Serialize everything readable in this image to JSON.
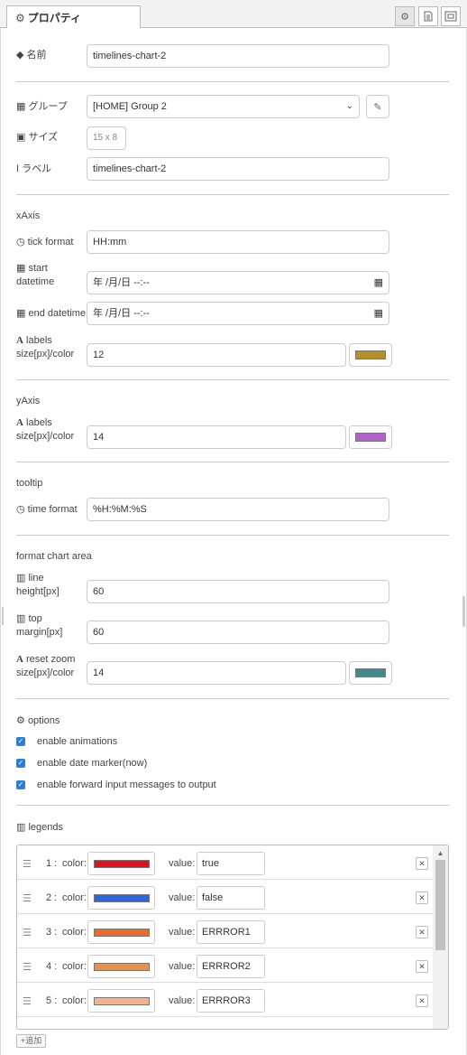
{
  "tab": {
    "title": "プロパティ"
  },
  "fields": {
    "name_label": "名前",
    "name_value": "timelines-chart-2",
    "group_label": "グループ",
    "group_value": "[HOME] Group 2",
    "size_label": "サイズ",
    "size_value": "15 x 8",
    "label_label": "ラベル",
    "label_value": "timelines-chart-2"
  },
  "xaxis": {
    "title": "xAxis",
    "tick_format_label": "tick format",
    "tick_format_value": "HH:mm",
    "start_label_1": "start",
    "start_label_2": "datetime",
    "start_value": "年 /月/日 --:--",
    "end_label": "end datetime",
    "end_value": "年 /月/日 --:--",
    "labels_label_1": "labels",
    "labels_label_2": "size[px]/color",
    "labels_size": "12",
    "labels_color": "#b58e27"
  },
  "yaxis": {
    "title": "yAxis",
    "labels_label_1": "labels",
    "labels_label_2": "size[px]/color",
    "labels_size": "14",
    "labels_color": "#b25fd0"
  },
  "tooltip": {
    "title": "tooltip",
    "time_format_label": "time format",
    "time_format_value": "%H:%M:%S"
  },
  "chart_area": {
    "title": "format chart area",
    "line_label_1": "line",
    "line_label_2": "height[px]",
    "line_value": "60",
    "top_label_1": "top",
    "top_label_2": "margin[px]",
    "top_value": "60",
    "reset_label_1": "reset zoom",
    "reset_label_2": "size[px]/color",
    "reset_size": "14",
    "reset_color": "#3f8a8a"
  },
  "options": {
    "title": "options",
    "items": [
      {
        "label": "enable animations",
        "checked": true
      },
      {
        "label": "enable date marker(now)",
        "checked": true
      },
      {
        "label": "enable forward input messages to output",
        "checked": true
      }
    ]
  },
  "legends": {
    "title": "legends",
    "color_label": "color:",
    "value_label": "value:",
    "rows": [
      {
        "num": "1 :",
        "color": "#e01020",
        "value": "true"
      },
      {
        "num": "2 :",
        "color": "#2e66e0",
        "value": "false"
      },
      {
        "num": "3 :",
        "color": "#ec6a2a",
        "value": "ERRROR1"
      },
      {
        "num": "4 :",
        "color": "#ee8f48",
        "value": "ERRROR2"
      },
      {
        "num": "5 :",
        "color": "#f2b28a",
        "value": "ERRROR3"
      }
    ],
    "add_label": "+追加"
  }
}
